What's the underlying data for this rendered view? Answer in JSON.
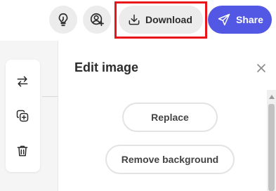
{
  "header": {
    "ideas_icon": "lightbulb-icon",
    "invite_icon": "add-person-icon",
    "download": {
      "label": "Download",
      "icon": "download-icon"
    },
    "share": {
      "label": "Share",
      "icon": "send-icon",
      "color": "#5258e4"
    },
    "highlight_color": "#e8141a"
  },
  "toolbar": {
    "tools": [
      {
        "name": "swap-icon"
      },
      {
        "name": "duplicate-icon"
      },
      {
        "name": "trash-icon"
      }
    ]
  },
  "panel": {
    "title": "Edit image",
    "close_icon": "close-icon",
    "replace_label": "Replace",
    "remove_bg_label": "Remove background"
  }
}
